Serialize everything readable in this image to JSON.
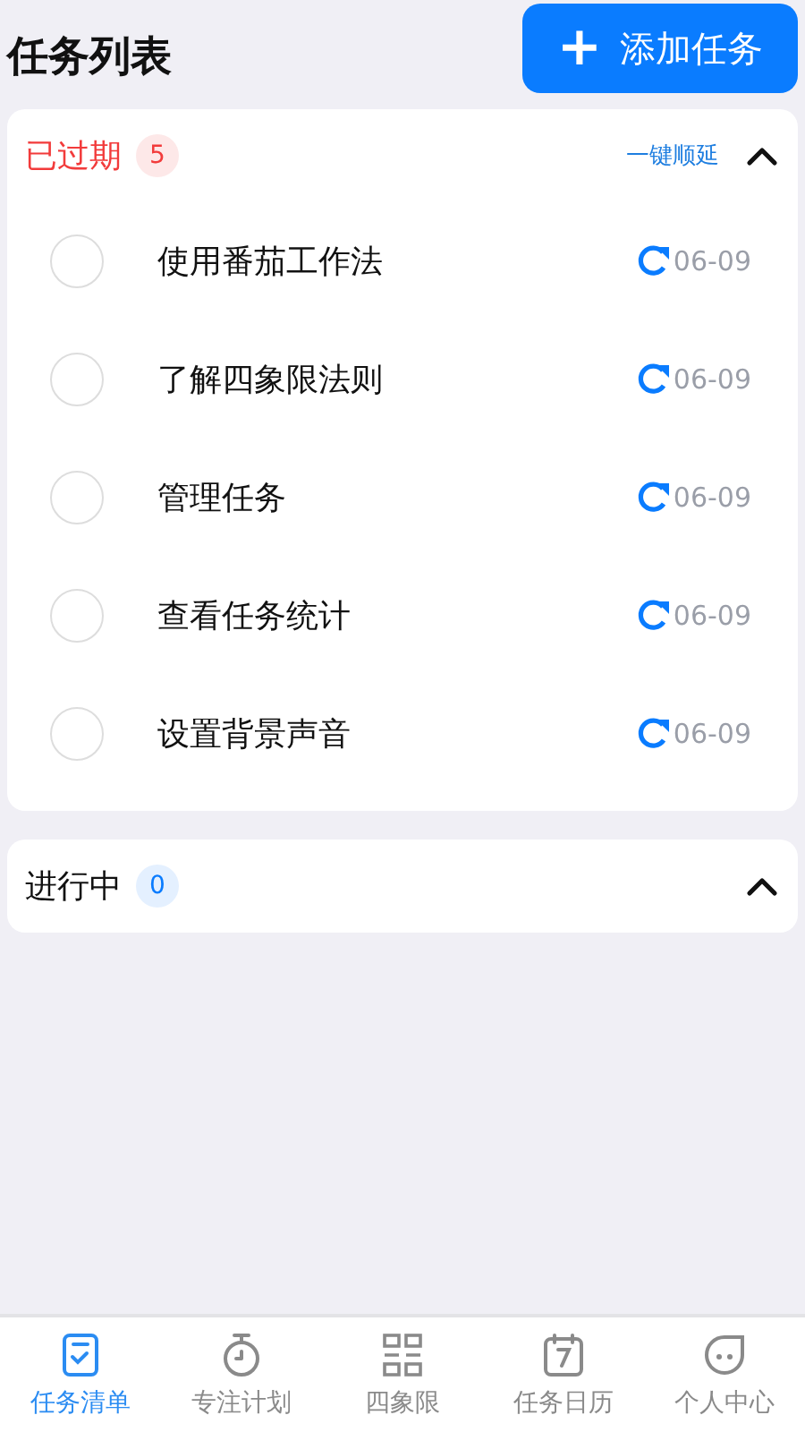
{
  "header": {
    "title": "任务列表",
    "add_button": {
      "icon": "+",
      "label": "添加任务"
    }
  },
  "sections": [
    {
      "kind": "overdue",
      "title": "已过期",
      "count": "5",
      "action": "一键顺延",
      "expanded": true,
      "tasks": [
        {
          "title": "使用番茄工作法",
          "checked": false,
          "date": "06-09"
        },
        {
          "title": "了解四象限法则",
          "checked": false,
          "date": "06-09"
        },
        {
          "title": "管理任务",
          "checked": false,
          "date": "06-09"
        },
        {
          "title": "查看任务统计",
          "checked": false,
          "date": "06-09"
        },
        {
          "title": "设置背景声音",
          "checked": false,
          "date": "06-09"
        }
      ]
    },
    {
      "kind": "active",
      "title": "进行中",
      "count": "0",
      "expanded": true
    }
  ],
  "tab_bar": [
    {
      "kind": "list",
      "label": "任务清单",
      "selected": true
    },
    {
      "kind": "timer",
      "label": "专注计划",
      "selected": false
    },
    {
      "kind": "grid",
      "label": "四象限",
      "selected": false
    },
    {
      "kind": "calendar",
      "label": "任务日历",
      "selected": false
    },
    {
      "kind": "face",
      "label": "个人中心",
      "selected": false
    }
  ]
}
